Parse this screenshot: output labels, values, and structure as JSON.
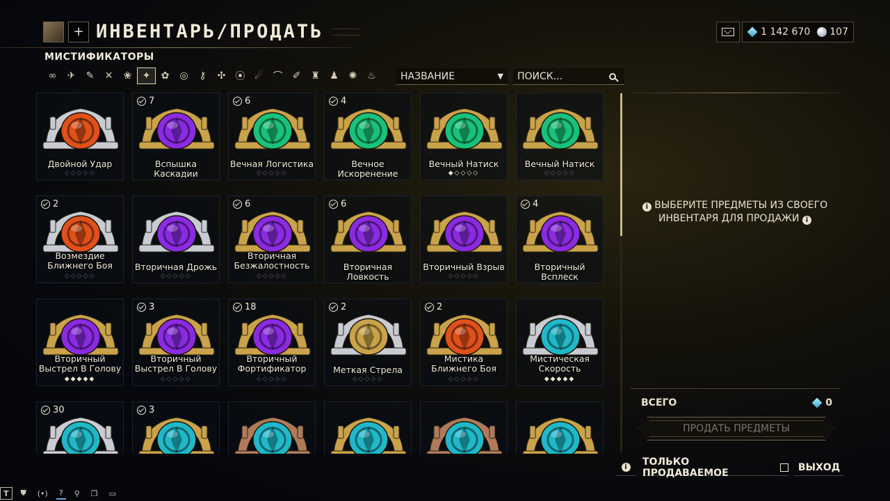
{
  "header": {
    "title": "ИНВЕНТАРЬ/ПРОДАТЬ",
    "plus_label": "+",
    "platinum": "1 142 670",
    "endo": "107"
  },
  "category": "МИСТИФИКАТОРЫ",
  "filters": [
    "∞",
    "✈",
    "✎",
    "✕",
    "❀",
    "✦",
    "✿",
    "◎",
    "⚷",
    "✣",
    "⦿",
    "☄",
    "⌒",
    "✐",
    "♜",
    "♟",
    "✺",
    "♨"
  ],
  "active_filter_index": 5,
  "sort": {
    "label": "НАЗВАНИЕ",
    "arrow": "▼"
  },
  "search": {
    "placeholder": "ПОИСК..."
  },
  "colors": {
    "orange": "#e0501a",
    "purple": "#8a2be2",
    "green": "#19c27a",
    "cyan": "#1fb8c8",
    "gold": "#c9a24a",
    "silver": "#c8ccd2",
    "copper": "#b07a5a"
  },
  "items": [
    {
      "name": "Двойной Удар",
      "count": "",
      "checked": false,
      "color": "orange",
      "frame": "silver",
      "rank": 0,
      "max_rank": 5
    },
    {
      "name": "Вспышка Каскадии",
      "count": "7",
      "checked": true,
      "color": "purple",
      "frame": "gold",
      "rank": 0,
      "max_rank": 5
    },
    {
      "name": "Вечная Логистика",
      "count": "6",
      "checked": true,
      "color": "green",
      "frame": "gold",
      "rank": 0,
      "max_rank": 5
    },
    {
      "name": "Вечное Искоренение",
      "count": "4",
      "checked": true,
      "color": "green",
      "frame": "gold",
      "rank": 0,
      "max_rank": 5
    },
    {
      "name": "Вечный Натиск",
      "count": "",
      "checked": false,
      "color": "green",
      "frame": "gold",
      "rank": 1,
      "max_rank": 5
    },
    {
      "name": "Вечный Натиск",
      "count": "",
      "checked": false,
      "color": "green",
      "frame": "gold",
      "rank": 0,
      "max_rank": 5
    },
    {
      "name": "Возмездие Ближнего Боя",
      "count": "2",
      "checked": true,
      "color": "orange",
      "frame": "silver",
      "rank": 0,
      "max_rank": 5
    },
    {
      "name": "Вторичная Дрожь",
      "count": "",
      "checked": false,
      "color": "purple",
      "frame": "silver",
      "rank": 0,
      "max_rank": 5
    },
    {
      "name": "Вторичная Безжалостность",
      "count": "6",
      "checked": true,
      "color": "purple",
      "frame": "gold",
      "rank": 0,
      "max_rank": 5
    },
    {
      "name": "Вторичная Ловкость",
      "count": "6",
      "checked": true,
      "color": "purple",
      "frame": "gold",
      "rank": 0,
      "max_rank": 5
    },
    {
      "name": "Вторичный Взрыв",
      "count": "",
      "checked": false,
      "color": "purple",
      "frame": "gold",
      "rank": 0,
      "max_rank": 5
    },
    {
      "name": "Вторичный Всплеск",
      "count": "4",
      "checked": true,
      "color": "purple",
      "frame": "gold",
      "rank": 0,
      "max_rank": 5
    },
    {
      "name": "Вторичный Выстрел В Голову",
      "count": "",
      "checked": false,
      "color": "purple",
      "frame": "gold",
      "rank": 5,
      "max_rank": 5
    },
    {
      "name": "Вторичный Выстрел В Голову",
      "count": "3",
      "checked": true,
      "color": "purple",
      "frame": "gold",
      "rank": 0,
      "max_rank": 5
    },
    {
      "name": "Вторичный Фортификатор",
      "count": "18",
      "checked": true,
      "color": "purple",
      "frame": "gold",
      "rank": 0,
      "max_rank": 5
    },
    {
      "name": "Меткая Стрела",
      "count": "2",
      "checked": true,
      "color": "gold",
      "frame": "silver",
      "rank": 0,
      "max_rank": 5
    },
    {
      "name": "Мистика Ближнего Боя",
      "count": "2",
      "checked": true,
      "color": "orange",
      "frame": "gold",
      "rank": 0,
      "max_rank": 5
    },
    {
      "name": "Мистическая Скорость",
      "count": "",
      "checked": false,
      "color": "cyan",
      "frame": "silver",
      "rank": 5,
      "max_rank": 5
    },
    {
      "name": "",
      "count": "30",
      "checked": true,
      "color": "cyan",
      "frame": "silver",
      "rank": 0,
      "max_rank": 5
    },
    {
      "name": "",
      "count": "3",
      "checked": true,
      "color": "cyan",
      "frame": "gold",
      "rank": 0,
      "max_rank": 5
    },
    {
      "name": "",
      "count": "",
      "checked": false,
      "color": "cyan",
      "frame": "copper",
      "rank": 0,
      "max_rank": 5
    },
    {
      "name": "",
      "count": "",
      "checked": false,
      "color": "cyan",
      "frame": "gold",
      "rank": 0,
      "max_rank": 5
    },
    {
      "name": "",
      "count": "",
      "checked": false,
      "color": "cyan",
      "frame": "copper",
      "rank": 0,
      "max_rank": 5
    },
    {
      "name": "",
      "count": "",
      "checked": false,
      "color": "cyan",
      "frame": "gold",
      "rank": 0,
      "max_rank": 5
    }
  ],
  "panel": {
    "message_line1": "ВЫБЕРИТЕ ПРЕДМЕТЫ ИЗ СВОЕГО",
    "message_line2": "ИНВЕНТАРЯ ДЛЯ ПРОДАЖИ",
    "info_glyph": "i",
    "total_label": "ВСЕГО",
    "total_value": "0",
    "sell_button": "ПРОДАТЬ ПРЕДМЕТЫ"
  },
  "bottom": {
    "info": "i",
    "sellable_only": "ТОЛЬКО ПРОДАВАЕМОЕ",
    "exit": "ВЫХОД"
  },
  "chat_tabs": [
    "T",
    "⛊",
    "(•)",
    "?",
    "⚲",
    "❐",
    "▭"
  ]
}
